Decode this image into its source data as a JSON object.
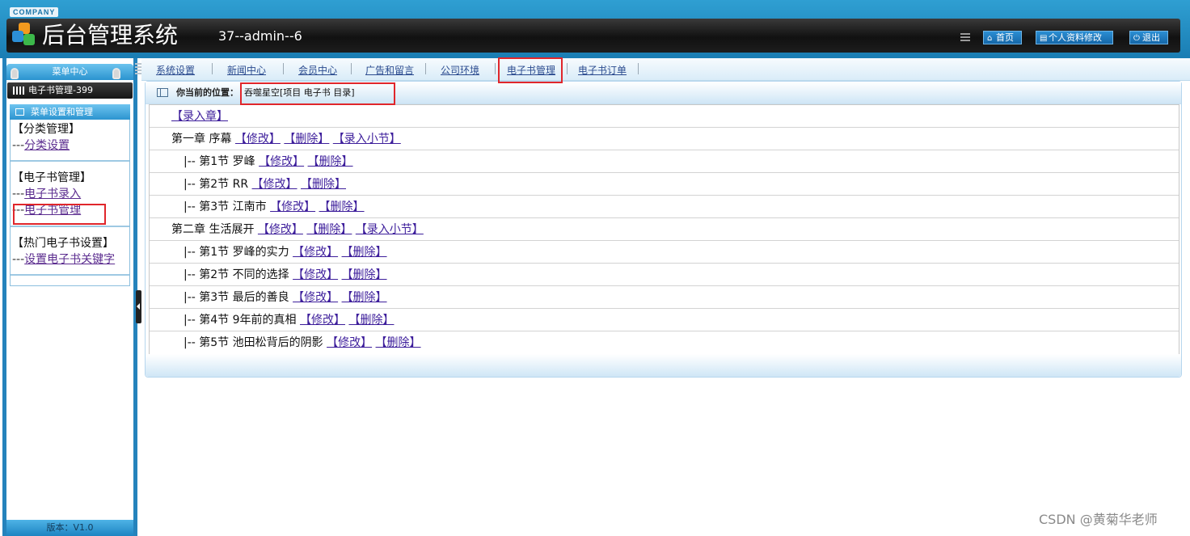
{
  "header": {
    "company": "COMPANY",
    "title": "后台管理系统",
    "user": "37--admin--6",
    "buttons": [
      {
        "label": "首页",
        "icon": "home-icon"
      },
      {
        "label": "个人资料修改",
        "icon": "profile-icon"
      },
      {
        "label": "退出",
        "icon": "power-icon"
      }
    ]
  },
  "sidebar": {
    "menu_center": "菜单中心",
    "current_module": "电子书管理-399",
    "section_title": "菜单设置和管理",
    "groups": [
      {
        "title": "【分类管理】",
        "links": [
          {
            "prefix": "---",
            "label": "分类设置"
          }
        ]
      },
      {
        "title": "【电子书管理】",
        "links": [
          {
            "prefix": "---",
            "label": "电子书录入"
          },
          {
            "prefix": "---",
            "label": "电子书管理"
          }
        ]
      },
      {
        "title": "【热门电子书设置】",
        "links": [
          {
            "prefix": "---",
            "label": "设置电子书关键字"
          }
        ]
      }
    ],
    "version": "版本：V1.0"
  },
  "nav_tabs": [
    "系统设置",
    "新闻中心",
    "会员中心",
    "广告和留言",
    "公司环境",
    "电子书管理",
    "电子书订单"
  ],
  "breadcrumb": {
    "label": "你当前的位置：",
    "value": "吞噬星空[项目 电子书 目录]"
  },
  "toc": {
    "add_chapter": "【录入章】",
    "edit": "【修改】",
    "delete": "【删除】",
    "add_section": "【录入小节】",
    "rows": [
      {
        "type": "chapter",
        "text": "第一章 序幕"
      },
      {
        "type": "section",
        "text": "|-- 第1节 罗峰"
      },
      {
        "type": "section",
        "text": "|-- 第2节 RR"
      },
      {
        "type": "section",
        "text": "|-- 第3节 江南市"
      },
      {
        "type": "chapter",
        "text": "第二章 生活展开"
      },
      {
        "type": "section",
        "text": "|-- 第1节 罗峰的实力"
      },
      {
        "type": "section",
        "text": "|-- 第2节 不同的选择"
      },
      {
        "type": "section",
        "text": "|-- 第3节 最后的善良"
      },
      {
        "type": "section",
        "text": "|-- 第4节 9年前的真相"
      },
      {
        "type": "section",
        "text": "|-- 第5节 池田松背后的阴影"
      }
    ]
  },
  "watermark": "CSDN @黄菊华老师",
  "colors": {
    "header_blue": "#2f9fd2",
    "title_bar": "#111111",
    "link": "#3d1e9b",
    "highlight": "#e0262b"
  }
}
